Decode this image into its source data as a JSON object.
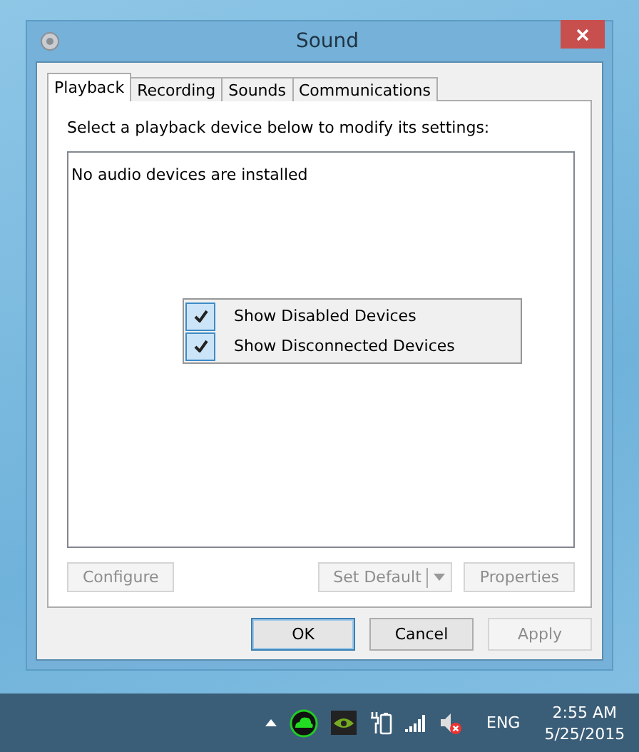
{
  "window": {
    "title": "Sound"
  },
  "tabs": [
    {
      "label": "Playback",
      "selected": true
    },
    {
      "label": "Recording",
      "selected": false
    },
    {
      "label": "Sounds",
      "selected": false
    },
    {
      "label": "Communications",
      "selected": false
    }
  ],
  "instruction": "Select a playback device below to modify its settings:",
  "device_list": {
    "empty_message": "No audio devices are installed"
  },
  "context_menu": [
    {
      "label": "Show Disabled Devices",
      "checked": true
    },
    {
      "label": "Show Disconnected Devices",
      "checked": true
    }
  ],
  "device_buttons": [
    {
      "label": "Configure",
      "kind": "plain",
      "disabled": true
    },
    {
      "label": "Set Default",
      "kind": "split",
      "disabled": true
    },
    {
      "label": "Properties",
      "kind": "plain",
      "disabled": true
    }
  ],
  "dialog_buttons": [
    {
      "label": "OK",
      "disabled": false,
      "selected": true
    },
    {
      "label": "Cancel",
      "disabled": false,
      "selected": false
    },
    {
      "label": "Apply",
      "disabled": true,
      "selected": false
    }
  ],
  "taskbar": {
    "language": "ENG",
    "time": "2:55 AM",
    "date": "5/25/2015"
  }
}
